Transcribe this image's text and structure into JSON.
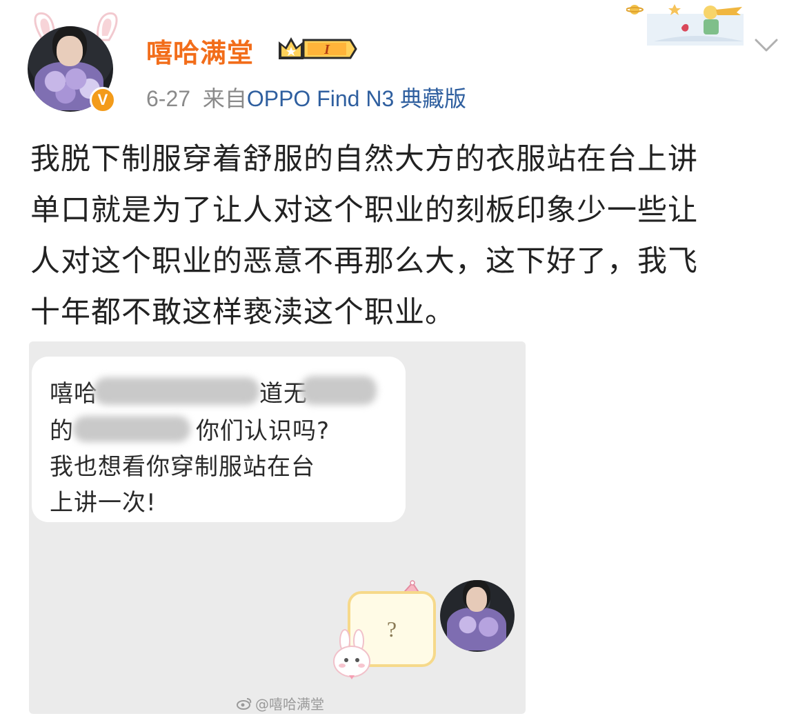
{
  "header": {
    "username": "嘻哈满堂",
    "vip_level": "I",
    "date": "6-27",
    "source_prefix": "来自",
    "device": "OPPO Find N3 典藏版",
    "verified_badge": "V"
  },
  "post": {
    "lines": [
      "我脱下制服穿着舒服的自然大方的衣服站在台上讲",
      "单口就是为了让人对这个职业的刻板印象少一些让",
      "人对这个职业的恶意不再那么大，这下好了，我飞",
      "十年都不敢这样亵渎这个职业。"
    ]
  },
  "screenshot": {
    "message_lines": [
      {
        "visible_start": "嘻哈",
        "visible_mid": "道无",
        "visible_end": ""
      },
      {
        "visible_start": "的",
        "visible_mid": "",
        "visible_end": "你们认识吗?"
      },
      {
        "visible_start": "我也想看你穿制服站在台",
        "visible_mid": "",
        "visible_end": ""
      },
      {
        "visible_start": "上讲一次!",
        "visible_mid": "",
        "visible_end": ""
      }
    ],
    "reply_symbol": "?",
    "watermark": "@嘻哈满堂"
  },
  "icons": {
    "verified": "verified-v-icon",
    "vip": "crown-vip-icon",
    "chevron": "chevron-down-icon",
    "weibo": "weibo-logo-icon"
  },
  "colors": {
    "username": "#f26d1a",
    "device_link": "#2f5f9f",
    "badge": "#f39b1a",
    "panel_bg": "#ebebeb"
  }
}
